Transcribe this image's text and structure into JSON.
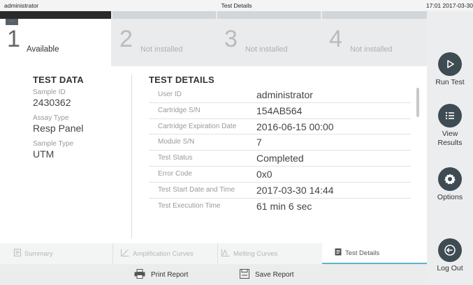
{
  "topbar": {
    "user": "administrator",
    "title": "Test Details",
    "clock": "17:01 2017-03-30"
  },
  "slots": [
    {
      "number": "1",
      "status": "Available"
    },
    {
      "number": "2",
      "status": "Not installed"
    },
    {
      "number": "3",
      "status": "Not installed"
    },
    {
      "number": "4",
      "status": "Not installed"
    }
  ],
  "test_data": {
    "heading": "TEST DATA",
    "fields": [
      {
        "label": "Sample ID",
        "value": "2430362"
      },
      {
        "label": "Assay Type",
        "value": "Resp Panel"
      },
      {
        "label": "Sample Type",
        "value": "UTM"
      }
    ]
  },
  "test_details": {
    "heading": "TEST DETAILS",
    "rows": [
      {
        "label": "User ID",
        "value": "administrator"
      },
      {
        "label": "Cartridge S/N",
        "value": "154AB564"
      },
      {
        "label": "Cartridge Expiration Date",
        "value": "2016-06-15 00:00"
      },
      {
        "label": "Module S/N",
        "value": "7"
      },
      {
        "label": "Test Status",
        "value": "Completed"
      },
      {
        "label": "Error Code",
        "value": "0x0"
      },
      {
        "label": "Test Start Date and Time",
        "value": "2017-03-30 14:44"
      },
      {
        "label": "Test Execution Time",
        "value": "61 min 6 sec"
      }
    ]
  },
  "tabs": [
    {
      "label": "Summary",
      "icon": "summary-icon"
    },
    {
      "label": "Amplification Curves",
      "icon": "amplification-icon"
    },
    {
      "label": "Melting Curves",
      "icon": "melting-icon"
    },
    {
      "label": "Test Details",
      "icon": "details-icon",
      "active": true
    }
  ],
  "actions": {
    "print": "Print Report",
    "save": "Save Report"
  },
  "sidebar": {
    "run_test": "Run Test",
    "view_results": "View Results",
    "options": "Options",
    "log_out": "Log Out"
  },
  "colors": {
    "accent": "#5fb3d0",
    "nav_circle": "#3f4b53",
    "active_slot_strip": "#2a2a2a"
  }
}
